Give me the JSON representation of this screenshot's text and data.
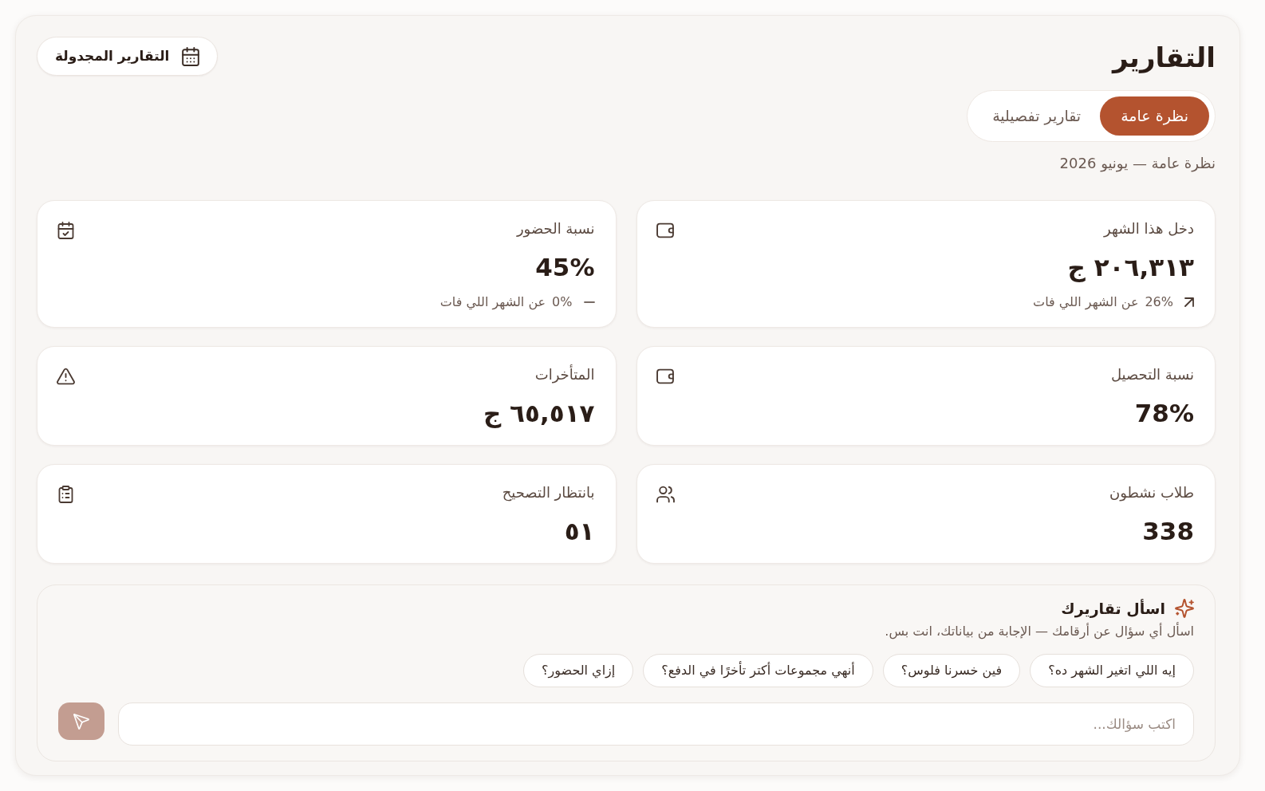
{
  "header": {
    "title": "التقارير",
    "scheduled_reports_button": {
      "label": "التقارير المجدولة"
    }
  },
  "tabs": [
    {
      "label": "نظرة عامة",
      "selected": true
    },
    {
      "label": "تقارير تفصيلية",
      "selected": false
    }
  ],
  "subtitle": "نظرة عامة — يونيو 2026",
  "stats": [
    {
      "label": "دخل هذا الشهر",
      "value": "٢٠٦,٣١٣ ج",
      "change": {
        "rising": true,
        "value": "26%",
        "note": "عن الشهر اللي فات"
      }
    },
    {
      "label": "نسبة الحضور",
      "value": "45%",
      "change": {
        "rising": false,
        "value": "0%",
        "note": "عن الشهر اللي فات"
      }
    },
    {
      "label": "نسبة التحصيل",
      "value": "78%"
    },
    {
      "label": "المتأخرات",
      "value": "٦٥,٥١٧ ج"
    },
    {
      "label": "طلاب نشطون",
      "value": "338"
    },
    {
      "label": "بانتظار التصحيح",
      "value": "٥١"
    }
  ],
  "ask": {
    "title": "اسأل تقاريرك",
    "description": "اسأل أي سؤال عن أرقامك — الإجابة من بياناتك، انت بس.",
    "suggestions": [
      "إيه اللي اتغير الشهر ده؟",
      "فين خسرنا فلوس؟",
      "أنهي مجموعات أكتر تأخرًا في الدفع؟",
      "إزاي الحضور؟"
    ],
    "input": {
      "placeholder": "اكتب سؤالك..."
    },
    "send_button": {
      "disabled": true
    }
  }
}
